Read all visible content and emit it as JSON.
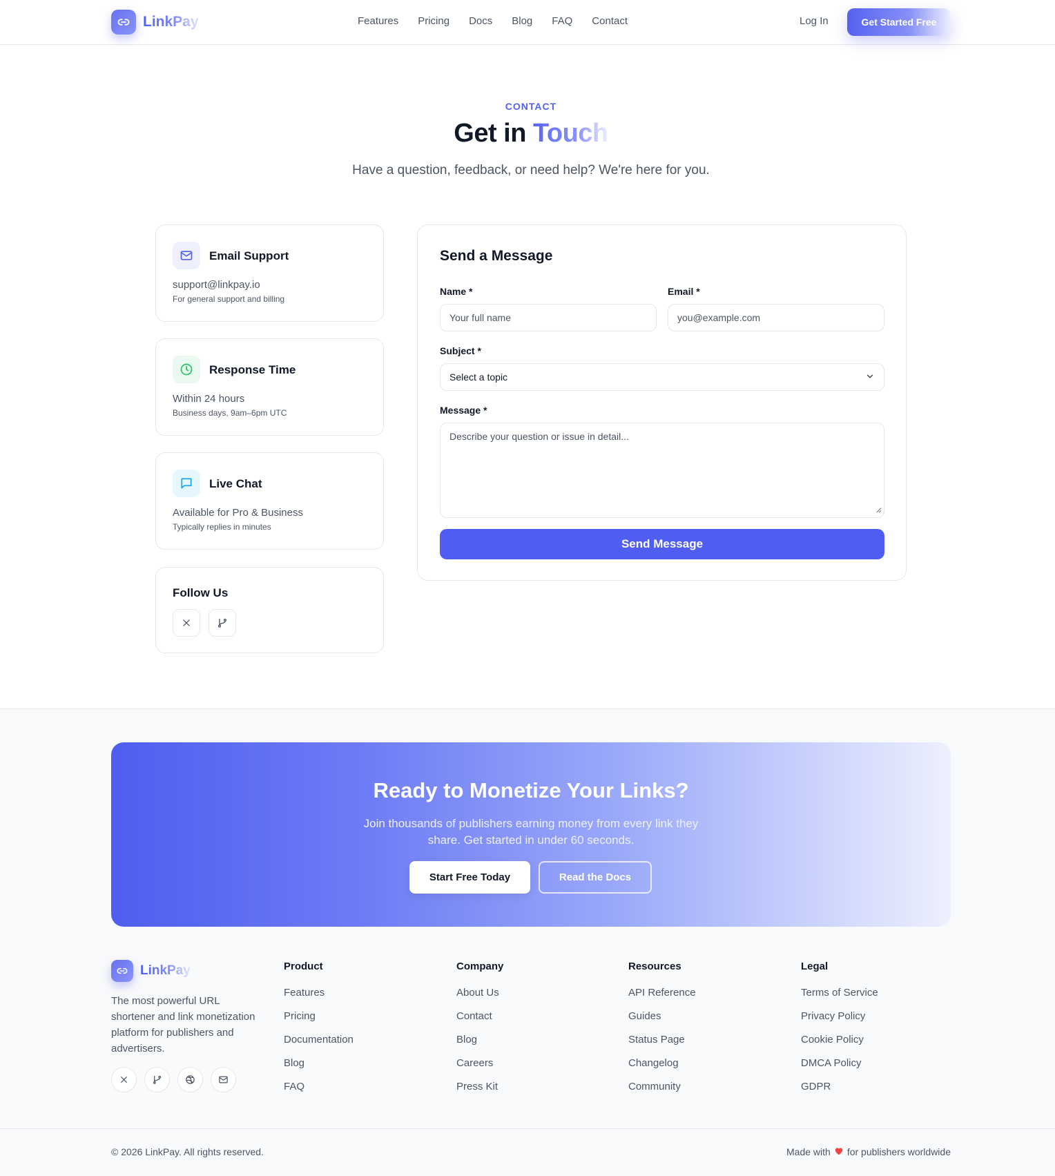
{
  "brand": {
    "name": "LinkPay",
    "accent": "#4f5ef0"
  },
  "nav": {
    "items": [
      {
        "label": "Features"
      },
      {
        "label": "Pricing"
      },
      {
        "label": "Docs"
      },
      {
        "label": "Blog"
      },
      {
        "label": "FAQ"
      },
      {
        "label": "Contact"
      }
    ],
    "login": "Log In",
    "cta": "Get Started Free"
  },
  "hero": {
    "eyebrow": "CONTACT",
    "title_plain": "Get in",
    "title_accent": "Touch",
    "subtitle": "Have a question, feedback, or need help? We're here for you."
  },
  "info_cards": [
    {
      "icon": "mail-icon",
      "title": "Email Support",
      "main": "support@linkpay.io",
      "sub": "For general support and billing"
    },
    {
      "icon": "clock-icon",
      "title": "Response Time",
      "main": "Within 24 hours",
      "sub": "Business days, 9am–6pm UTC"
    },
    {
      "icon": "chat-icon",
      "title": "Live Chat",
      "main": "Available for Pro & Business",
      "sub": "Typically replies in minutes"
    }
  ],
  "follow": {
    "title": "Follow Us",
    "icons": [
      "x-icon",
      "git-branch-icon"
    ]
  },
  "form": {
    "title": "Send a Message",
    "name_label": "Name *",
    "name_placeholder": "Your full name",
    "email_label": "Email *",
    "email_placeholder": "you@example.com",
    "subject_label": "Subject *",
    "subject_value": "Select a topic",
    "message_label": "Message *",
    "message_placeholder": "Describe your question or issue in detail...",
    "submit": "Send Message"
  },
  "cta": {
    "title": "Ready to Monetize Your Links?",
    "text": "Join thousands of publishers earning money from every link they share. Get started in under 60 seconds.",
    "primary": "Start Free Today",
    "secondary": "Read the Docs"
  },
  "footer": {
    "description": "The most powerful URL shortener and link monetization platform for publishers and advertisers.",
    "social_icons": [
      "x-icon",
      "git-branch-icon",
      "dribbble-icon",
      "mail-icon"
    ],
    "columns": [
      {
        "title": "Product",
        "links": [
          "Features",
          "Pricing",
          "Documentation",
          "Blog",
          "FAQ"
        ]
      },
      {
        "title": "Company",
        "links": [
          "About Us",
          "Contact",
          "Blog",
          "Careers",
          "Press Kit"
        ]
      },
      {
        "title": "Resources",
        "links": [
          "API Reference",
          "Guides",
          "Status Page",
          "Changelog",
          "Community"
        ]
      },
      {
        "title": "Legal",
        "links": [
          "Terms of Service",
          "Privacy Policy",
          "Cookie Policy",
          "DMCA Policy",
          "GDPR"
        ]
      }
    ],
    "copyright": "© 2026 LinkPay. All rights reserved.",
    "made_prefix": "Made with",
    "made_suffix": "for publishers worldwide",
    "heart_color": "#ef4444"
  }
}
